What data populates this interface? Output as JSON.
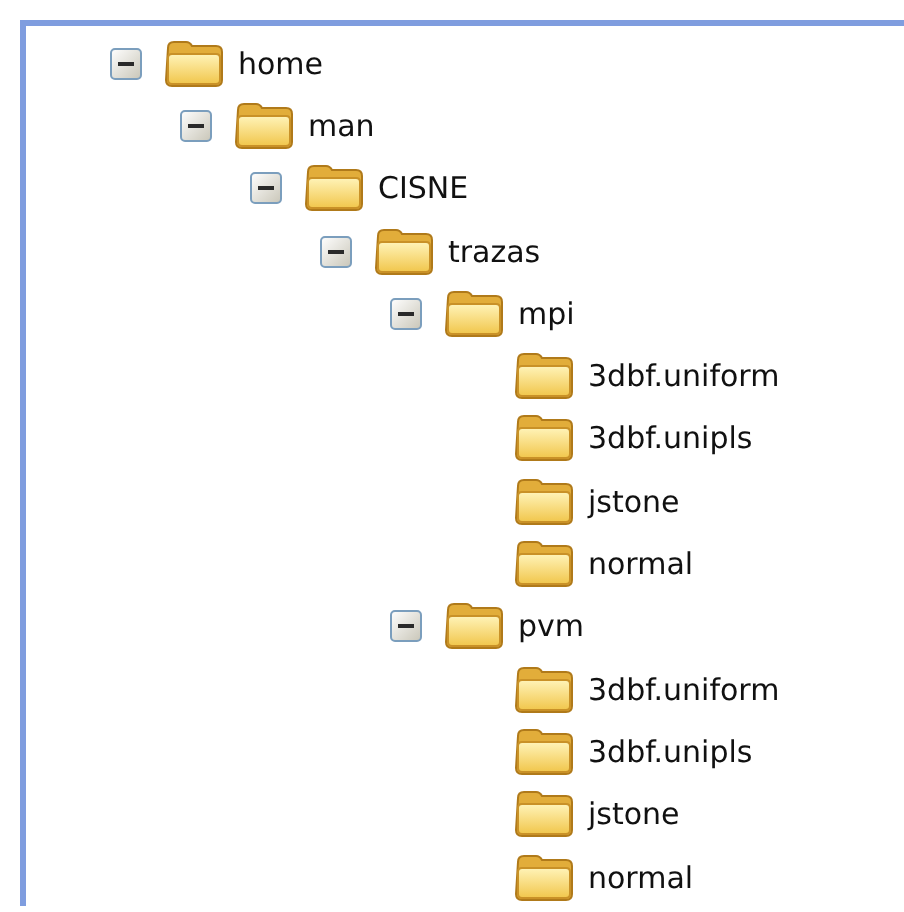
{
  "tree": [
    {
      "label": "home",
      "expanded": true,
      "children": [
        {
          "label": "man",
          "expanded": true,
          "children": [
            {
              "label": "CISNE",
              "expanded": true,
              "children": [
                {
                  "label": "trazas",
                  "expanded": true,
                  "children": [
                    {
                      "label": "mpi",
                      "expanded": true,
                      "children": [
                        {
                          "label": "3dbf.uniform"
                        },
                        {
                          "label": "3dbf.unipls"
                        },
                        {
                          "label": "jstone"
                        },
                        {
                          "label": "normal"
                        }
                      ]
                    },
                    {
                      "label": "pvm",
                      "expanded": true,
                      "children": [
                        {
                          "label": "3dbf.uniform"
                        },
                        {
                          "label": "3dbf.unipls"
                        },
                        {
                          "label": "jstone"
                        },
                        {
                          "label": "normal"
                        }
                      ]
                    }
                  ]
                }
              ]
            }
          ]
        }
      ]
    }
  ]
}
